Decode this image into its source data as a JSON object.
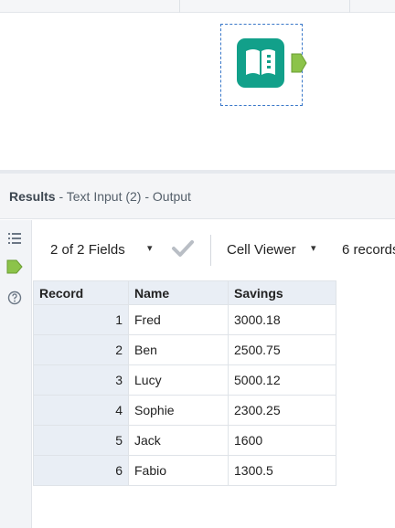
{
  "canvas": {
    "tool_icon": "text-input-book-icon",
    "accent_color": "#12a08a",
    "anchor_color": "#8cc34a"
  },
  "results": {
    "title_bold": "Results",
    "title_rest": " - Text Input (2) - Output"
  },
  "side_rail": {
    "icons": [
      "list-icon",
      "output-anchor-icon",
      "help-icon"
    ]
  },
  "toolbar": {
    "fields_label": "2 of 2 Fields",
    "caret": "▾",
    "check_icon": "check-icon",
    "viewer_label": "Cell Viewer",
    "records_label": "6 records"
  },
  "grid": {
    "headers": [
      "Record",
      "Name",
      "Savings"
    ],
    "rows": [
      {
        "record": "1",
        "name": "Fred",
        "savings": "3000.18"
      },
      {
        "record": "2",
        "name": "Ben",
        "savings": "2500.75"
      },
      {
        "record": "3",
        "name": "Lucy",
        "savings": "5000.12"
      },
      {
        "record": "4",
        "name": "Sophie",
        "savings": "2300.25"
      },
      {
        "record": "5",
        "name": "Jack",
        "savings": "1600"
      },
      {
        "record": "6",
        "name": "Fabio",
        "savings": "1300.5"
      }
    ]
  }
}
